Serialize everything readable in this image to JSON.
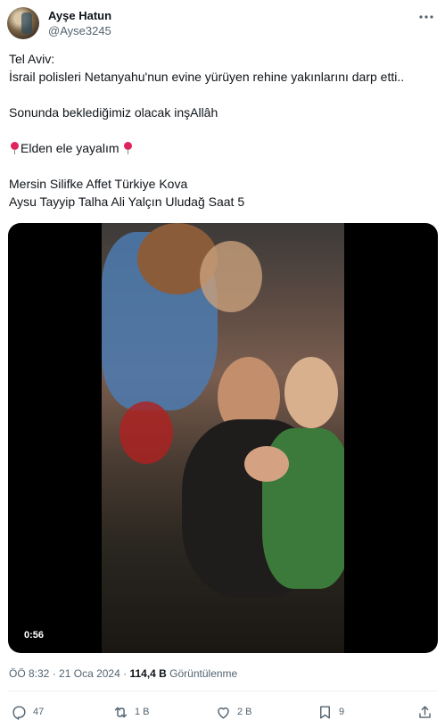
{
  "author": {
    "name": "Ayşe Hatun",
    "handle": "@Ayse3245"
  },
  "icons": {
    "more": "more-dots-icon",
    "reply": "reply-icon",
    "retweet": "retweet-icon",
    "like": "heart-icon",
    "bookmark": "bookmark-icon",
    "share": "share-icon",
    "pin": "round-pushpin-icon"
  },
  "tweet": {
    "line1": "Tel Aviv:",
    "line2": "İsrail polisleri Netanyahu'nun evine yürüyen rehine yakınlarını darp etti..",
    "line3": "Sonunda beklediğimiz olacak inşAllâh",
    "line4": "Elden ele yayalım",
    "line5": "Mersin Silifke Affet Türkiye Kova",
    "line6": "Aysu Tayyip Talha Ali Yalçın Uludağ Saat 5"
  },
  "media": {
    "duration": "0:56"
  },
  "meta": {
    "time": "ÖÖ 8:32",
    "separator": "·",
    "date": "21 Oca 2024",
    "views_count": "114,4 B",
    "views_label": "Görüntülenme"
  },
  "actions": {
    "replies": "47",
    "retweets": "1 B",
    "likes": "2 B",
    "bookmarks": "9"
  },
  "colors": {
    "text_primary": "#0f1419",
    "text_secondary": "#536471",
    "pin_red": "#e0245e"
  }
}
